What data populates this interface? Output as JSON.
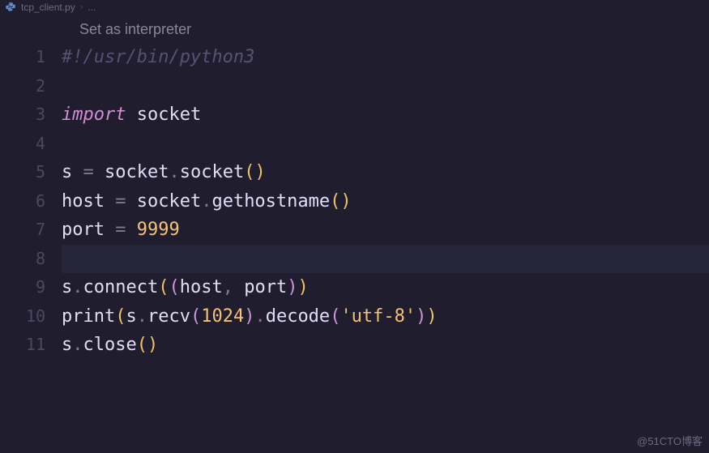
{
  "breadcrumb": {
    "file_icon": "python-file-icon",
    "filename": "tcp_client.py",
    "trail": "..."
  },
  "hint": "Set as interpreter",
  "gutter": [
    "1",
    "2",
    "3",
    "4",
    "5",
    "6",
    "7",
    "8",
    "9",
    "10",
    "11"
  ],
  "code": {
    "l1": {
      "shebang": "#!/usr/bin/python3"
    },
    "l3": {
      "import_kw": "import",
      "module": " socket"
    },
    "l5": {
      "lhs": "s ",
      "eq": "=",
      "pre": " socket",
      "dot1": ".",
      "call": "socket",
      "lp": "(",
      "rp": ")"
    },
    "l6": {
      "lhs": "host ",
      "eq": "=",
      "pre": " socket",
      "dot1": ".",
      "call": "gethostname",
      "lp": "(",
      "rp": ")"
    },
    "l7": {
      "lhs": "port ",
      "eq": "=",
      "val": " 9999"
    },
    "l9": {
      "obj": "s",
      "dot": ".",
      "call": "connect",
      "lp": "(",
      "ilp": "(",
      "arg1": "host",
      "comma": ", ",
      "arg2": "port",
      "irp": ")",
      "rp": ")"
    },
    "l10": {
      "fn": "print",
      "lp": "(",
      "obj": "s",
      "dot1": ".",
      "call1": "recv",
      "ilp": "(",
      "num": "1024",
      "irp": ")",
      "dot2": ".",
      "call2": "decode",
      "ilp2": "(",
      "str": "'utf-8'",
      "irp2": ")",
      "rp": ")"
    },
    "l11": {
      "obj": "s",
      "dot": ".",
      "call": "close",
      "lp": "(",
      "rp": ")"
    }
  },
  "watermark": "@51CTO博客"
}
